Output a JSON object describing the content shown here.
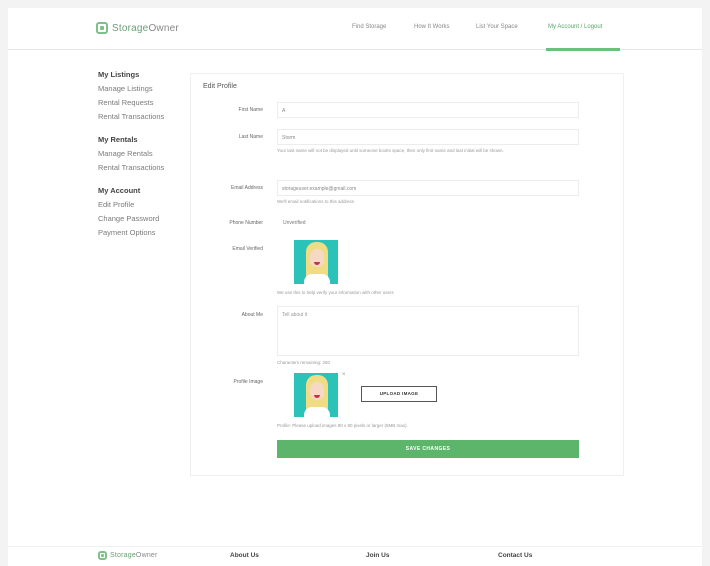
{
  "brand": {
    "name_part1": "Storage",
    "name_part2": "Owner"
  },
  "nav": {
    "items": [
      "Find Storage",
      "How It Works",
      "List Your Space",
      "My Account / Logout"
    ]
  },
  "sidebar": {
    "groups": [
      {
        "heading": "My Listings",
        "items": [
          "Manage Listings",
          "Rental Requests",
          "Rental Transactions"
        ]
      },
      {
        "heading": "My Rentals",
        "items": [
          "Manage Rentals",
          "Rental Transactions"
        ]
      },
      {
        "heading": "My Account",
        "items": [
          "Edit Profile",
          "Change Password",
          "Payment Options"
        ]
      }
    ]
  },
  "form": {
    "title": "Edit Profile",
    "first_name_label": "First Name",
    "first_name_value": "A",
    "last_name_label": "Last Name",
    "last_name_value": "Storm",
    "last_name_note": "Your last name will not be displayed until someone books space, then only first name and last initial will be shown.",
    "email_label": "Email Address",
    "email_value": "storageuser.example@gmail.com",
    "email_note": "We'll email notifications to this address",
    "phone_label": "Phone Number",
    "phone_value": "Unverified",
    "badge_label": "Email Verified",
    "badge_note": "We use this to help verify your information with other users",
    "about_label": "About Me",
    "about_placeholder": "Tell about it",
    "about_note": "Characters remaining: 250",
    "profile_image_label": "Profile Image",
    "upload_label": "UPLOAD IMAGE",
    "close_glyph": "×",
    "image_note": "Profile: Please upload images 80 x 80 pixels or larger (5MB max).",
    "save_label": "SAVE CHANGES"
  },
  "footer": {
    "columns": [
      "About Us",
      "Join Us",
      "Contact Us"
    ]
  },
  "colors": {
    "accent": "#5cb56a",
    "nav_active": "#5aa768"
  }
}
